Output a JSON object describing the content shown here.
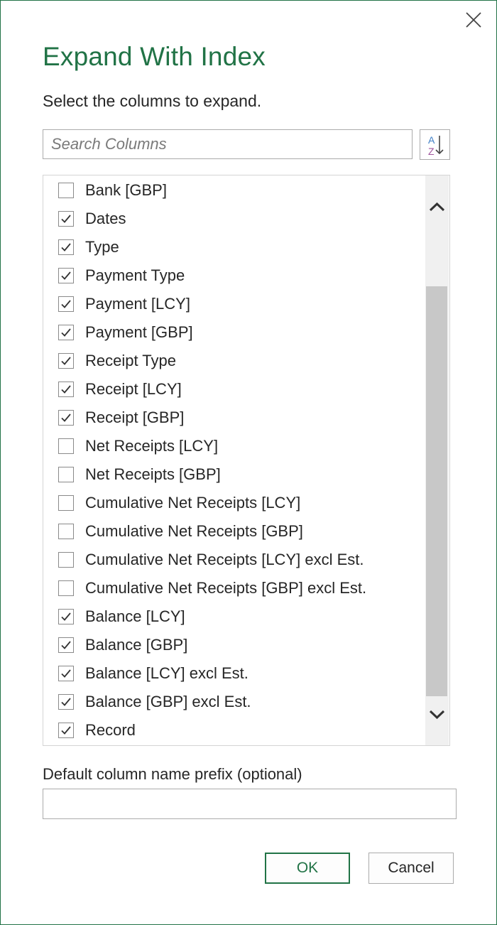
{
  "dialog": {
    "title": "Expand With Index",
    "subtitle": "Select the columns to expand.",
    "accent_color": "#217346",
    "close_icon": "close-icon"
  },
  "search": {
    "placeholder": "Search Columns",
    "value": "",
    "sort_icon": "sort-az-icon"
  },
  "columns": [
    {
      "label": "Bank [GBP]",
      "checked": false
    },
    {
      "label": "Dates",
      "checked": true
    },
    {
      "label": "Type",
      "checked": true
    },
    {
      "label": "Payment Type",
      "checked": true
    },
    {
      "label": "Payment [LCY]",
      "checked": true
    },
    {
      "label": "Payment [GBP]",
      "checked": true
    },
    {
      "label": "Receipt Type",
      "checked": true
    },
    {
      "label": "Receipt [LCY]",
      "checked": true
    },
    {
      "label": "Receipt [GBP]",
      "checked": true
    },
    {
      "label": "Net Receipts [LCY]",
      "checked": false
    },
    {
      "label": "Net Receipts [GBP]",
      "checked": false
    },
    {
      "label": "Cumulative Net Receipts [LCY]",
      "checked": false
    },
    {
      "label": "Cumulative Net Receipts [GBP]",
      "checked": false
    },
    {
      "label": "Cumulative Net Receipts [LCY] excl Est.",
      "checked": false
    },
    {
      "label": "Cumulative Net Receipts [GBP] excl Est.",
      "checked": false
    },
    {
      "label": "Balance [LCY]",
      "checked": true
    },
    {
      "label": "Balance [GBP]",
      "checked": true
    },
    {
      "label": "Balance [LCY] excl Est.",
      "checked": true
    },
    {
      "label": "Balance [GBP] excl Est.",
      "checked": true
    },
    {
      "label": "Record",
      "checked": true
    }
  ],
  "prefix": {
    "label": "Default column name prefix (optional)",
    "value": ""
  },
  "buttons": {
    "ok": "OK",
    "cancel": "Cancel"
  }
}
